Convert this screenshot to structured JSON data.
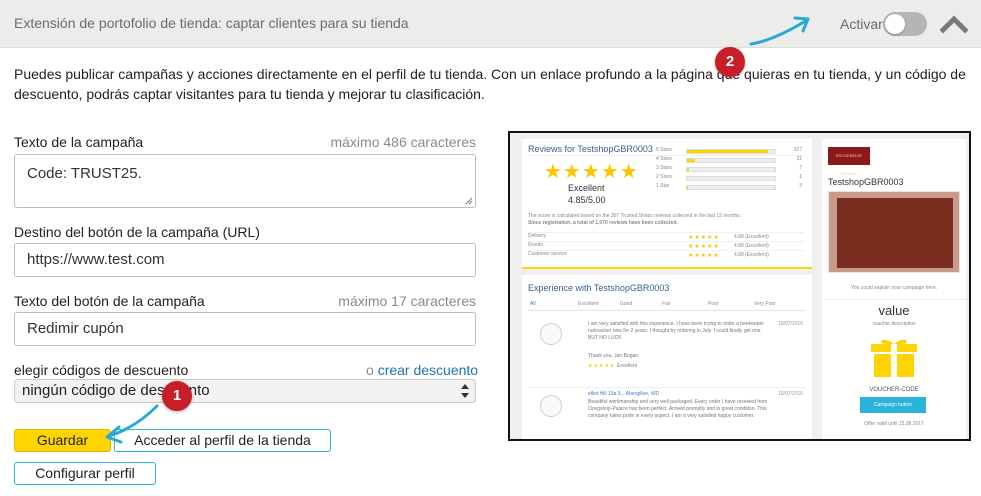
{
  "header": {
    "title": "Extensión de portofolio de tienda: captar clientes para su tienda",
    "toggle_label": "Activar",
    "toggle_state": "off",
    "chevron_icon": "chevron-up-icon"
  },
  "intro_text": "Puedes publicar campañas y acciones directamente en el perfil de tu tienda. Con un enlace profundo a la página que quieras en tu tienda, y un código de descuento, podrás captar visitantes para tu tienda y mejorar tu clasificación.",
  "form": {
    "campaign_text_label": "Texto de la campaña",
    "campaign_text_hint": "máximo 486 caracteres",
    "campaign_text_value": "Code: TRUST25.",
    "url_label": "Destino del botón de la campaña (URL)",
    "url_value": "https://www.test.com",
    "button_text_label": "Texto del botón de la campaña",
    "button_text_hint": "máximo 17 caracteres",
    "button_text_value": "Redimir cupón",
    "discount_label": "elegir códigos de descuento",
    "discount_link_prefix": "o",
    "discount_link": "crear descuento",
    "discount_selected": "ningún código de descuento"
  },
  "buttons": {
    "save": "Guardar",
    "profile": "Acceder al perfil de la tienda",
    "configure": "Configurar perfil"
  },
  "badges": {
    "one": "1",
    "two": "2"
  },
  "colors": {
    "accent_yellow": "#ffd400",
    "outline_blue": "#2ab3d8",
    "badge_red": "#c81e2a",
    "arrow_blue": "#2aa8d6"
  },
  "preview": {
    "reviews_title": "Reviews for TestshopGBR0003",
    "rating_word": "Excellent",
    "rating_value": "4.85/5.00",
    "bars": [
      {
        "label": "5 Stars",
        "fraction": 0.92,
        "count": "327"
      },
      {
        "label": "4 Stars",
        "fraction": 0.09,
        "count": "31"
      },
      {
        "label": "3 Stars",
        "fraction": 0.02,
        "count": "7"
      },
      {
        "label": "2 Stars",
        "fraction": 0.0,
        "count": "1"
      },
      {
        "label": "1 Star",
        "fraction": 0.01,
        "count": "3"
      }
    ],
    "score_note": "The score is calculated based on the 307 Trusted Shops reviews collected in the last 12 months.",
    "registration_note": "Since registration, a total of 1,070 reviews have been collected.",
    "criteria": [
      {
        "name": "Delivery",
        "value": "4.88 (Excellent)"
      },
      {
        "name": "Goods",
        "value": "4.88 (Excellent)"
      },
      {
        "name": "Customer service",
        "value": "4.88 (Excellent)"
      }
    ],
    "experience_title": "Experience with TestshopGBR0003",
    "tabs": [
      "All",
      "Excellent",
      "Good",
      "Fair",
      "Poor",
      "Very Poor"
    ],
    "review1_text": "I am very satisfied with this experience. I have been trying to order a beekeeper nutcracker now for 2 years. I thought by ordering in July. I could finally get one BUT NO LUCK",
    "review1_date": "18/07/2016",
    "review1_sign": "Thank you, Jan Bogan",
    "review1_rating": "Excellent",
    "review2_author": "elliot Hill 19a 9... Abergilloe, WD",
    "review2_text": "Beautiful workmanship and very well packaged. Every order I have received from Ozegshop-Palace has been perfect. Arrived promptly and in great condition. This company takes pride in every aspect. I am a very satisfied happy customer.",
    "review2_date": "18/07/2016",
    "shop_name": "TestshopGBR0003",
    "shop_logo_text": "ERZGEBIRGE PALACE",
    "campaign_hint": "You could explain your campaign here.",
    "voucher_value": "value",
    "voucher_desc": "voucher description",
    "voucher_code": "VOUCHER-CODE",
    "campaign_button": "Campaign button",
    "offer_valid": "Offer valid until 15.08.2017"
  }
}
